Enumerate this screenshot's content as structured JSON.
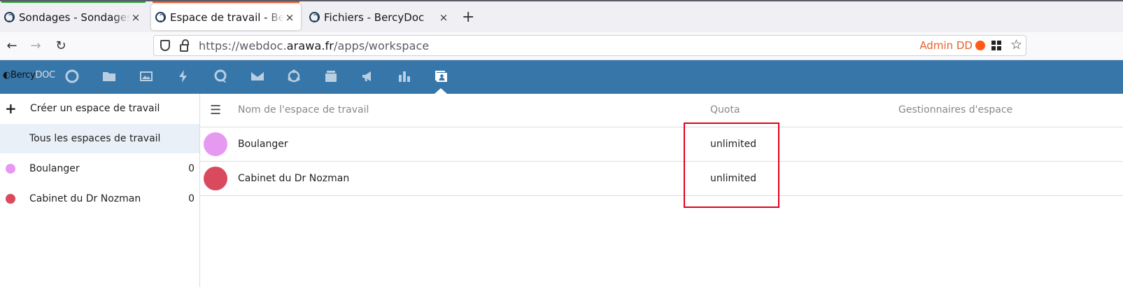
{
  "browser": {
    "tabs": [
      {
        "title": "Sondages - Sondages qu",
        "accent": "#22a639",
        "active": false
      },
      {
        "title": "Espace de travail - BercyD",
        "accent": "#e2582c",
        "active": true
      },
      {
        "title": "Fichiers - BercyDoc",
        "accent": "",
        "active": false
      }
    ],
    "close_glyph": "×",
    "new_tab_glyph": "+",
    "url": {
      "prefix": "https://webdoc.",
      "domain": "arawa.fr",
      "path": "/apps/workspace"
    },
    "user_label": "Admin DD",
    "icons": [
      "back-icon",
      "forward-icon",
      "reload-icon",
      "shield-icon",
      "lock-icon",
      "extensions-grid-icon",
      "bookmark-star-icon"
    ]
  },
  "app": {
    "logo": {
      "part1": "Bercy",
      "part2": "DOC"
    },
    "header_color": "#3776a9",
    "nav_icons": [
      "dashboard-icon",
      "files-icon",
      "photos-icon",
      "activity-icon",
      "talk-icon",
      "mail-icon",
      "sync-icon",
      "deck-icon",
      "announcements-icon",
      "polls-icon",
      "workspace-icon"
    ]
  },
  "sidebar": {
    "create_label": "Créer un espace de travail",
    "all_label": "Tous les espaces de travail",
    "workspaces": [
      {
        "label": "Boulanger",
        "count": "0",
        "color": "#e699f0"
      },
      {
        "label": "Cabinet du Dr Nozman",
        "count": "0",
        "color": "#d94a5f"
      }
    ]
  },
  "table": {
    "headers": {
      "name": "Nom de l'espace de travail",
      "quota": "Quota",
      "managers": "Gestionnaires d'espace"
    },
    "rows": [
      {
        "name": "Boulanger",
        "quota": "unlimited",
        "color": "#e699f0"
      },
      {
        "name": "Cabinet du Dr Nozman",
        "quota": "unlimited",
        "color": "#d94a5f"
      }
    ]
  },
  "annotation": {
    "color": "#e3001b"
  }
}
